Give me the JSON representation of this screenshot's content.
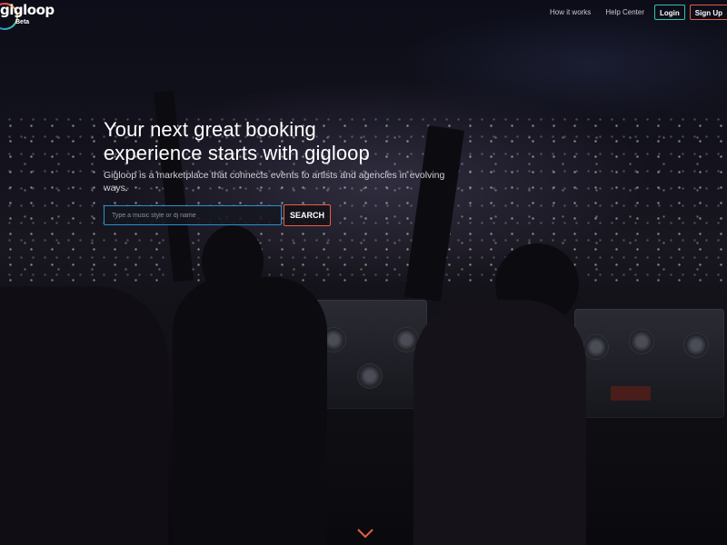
{
  "brand": {
    "logo_text": "gigloop",
    "beta_label": "Beta"
  },
  "nav": {
    "how_it_works": "How it works",
    "help_center": "Help Center",
    "login": "Login",
    "sign_up": "Sign Up"
  },
  "hero": {
    "headline_line1": "Your next great booking",
    "headline_line2": "experience starts with gigloop",
    "subtitle": "Gigloop is a marketplace that connects events to artists and agencies in evolving ways."
  },
  "search": {
    "placeholder": "Type a music style or dj name",
    "value": "",
    "button_label": "SEARCH"
  },
  "icons": {
    "scroll_down": "chevron-down-icon",
    "logo": "gigloop-ring-logo"
  },
  "colors": {
    "accent_teal": "#2ec4b6",
    "accent_orange": "#e85d43",
    "input_border_blue": "#2a8fd0",
    "chevron": "#e85d43"
  }
}
